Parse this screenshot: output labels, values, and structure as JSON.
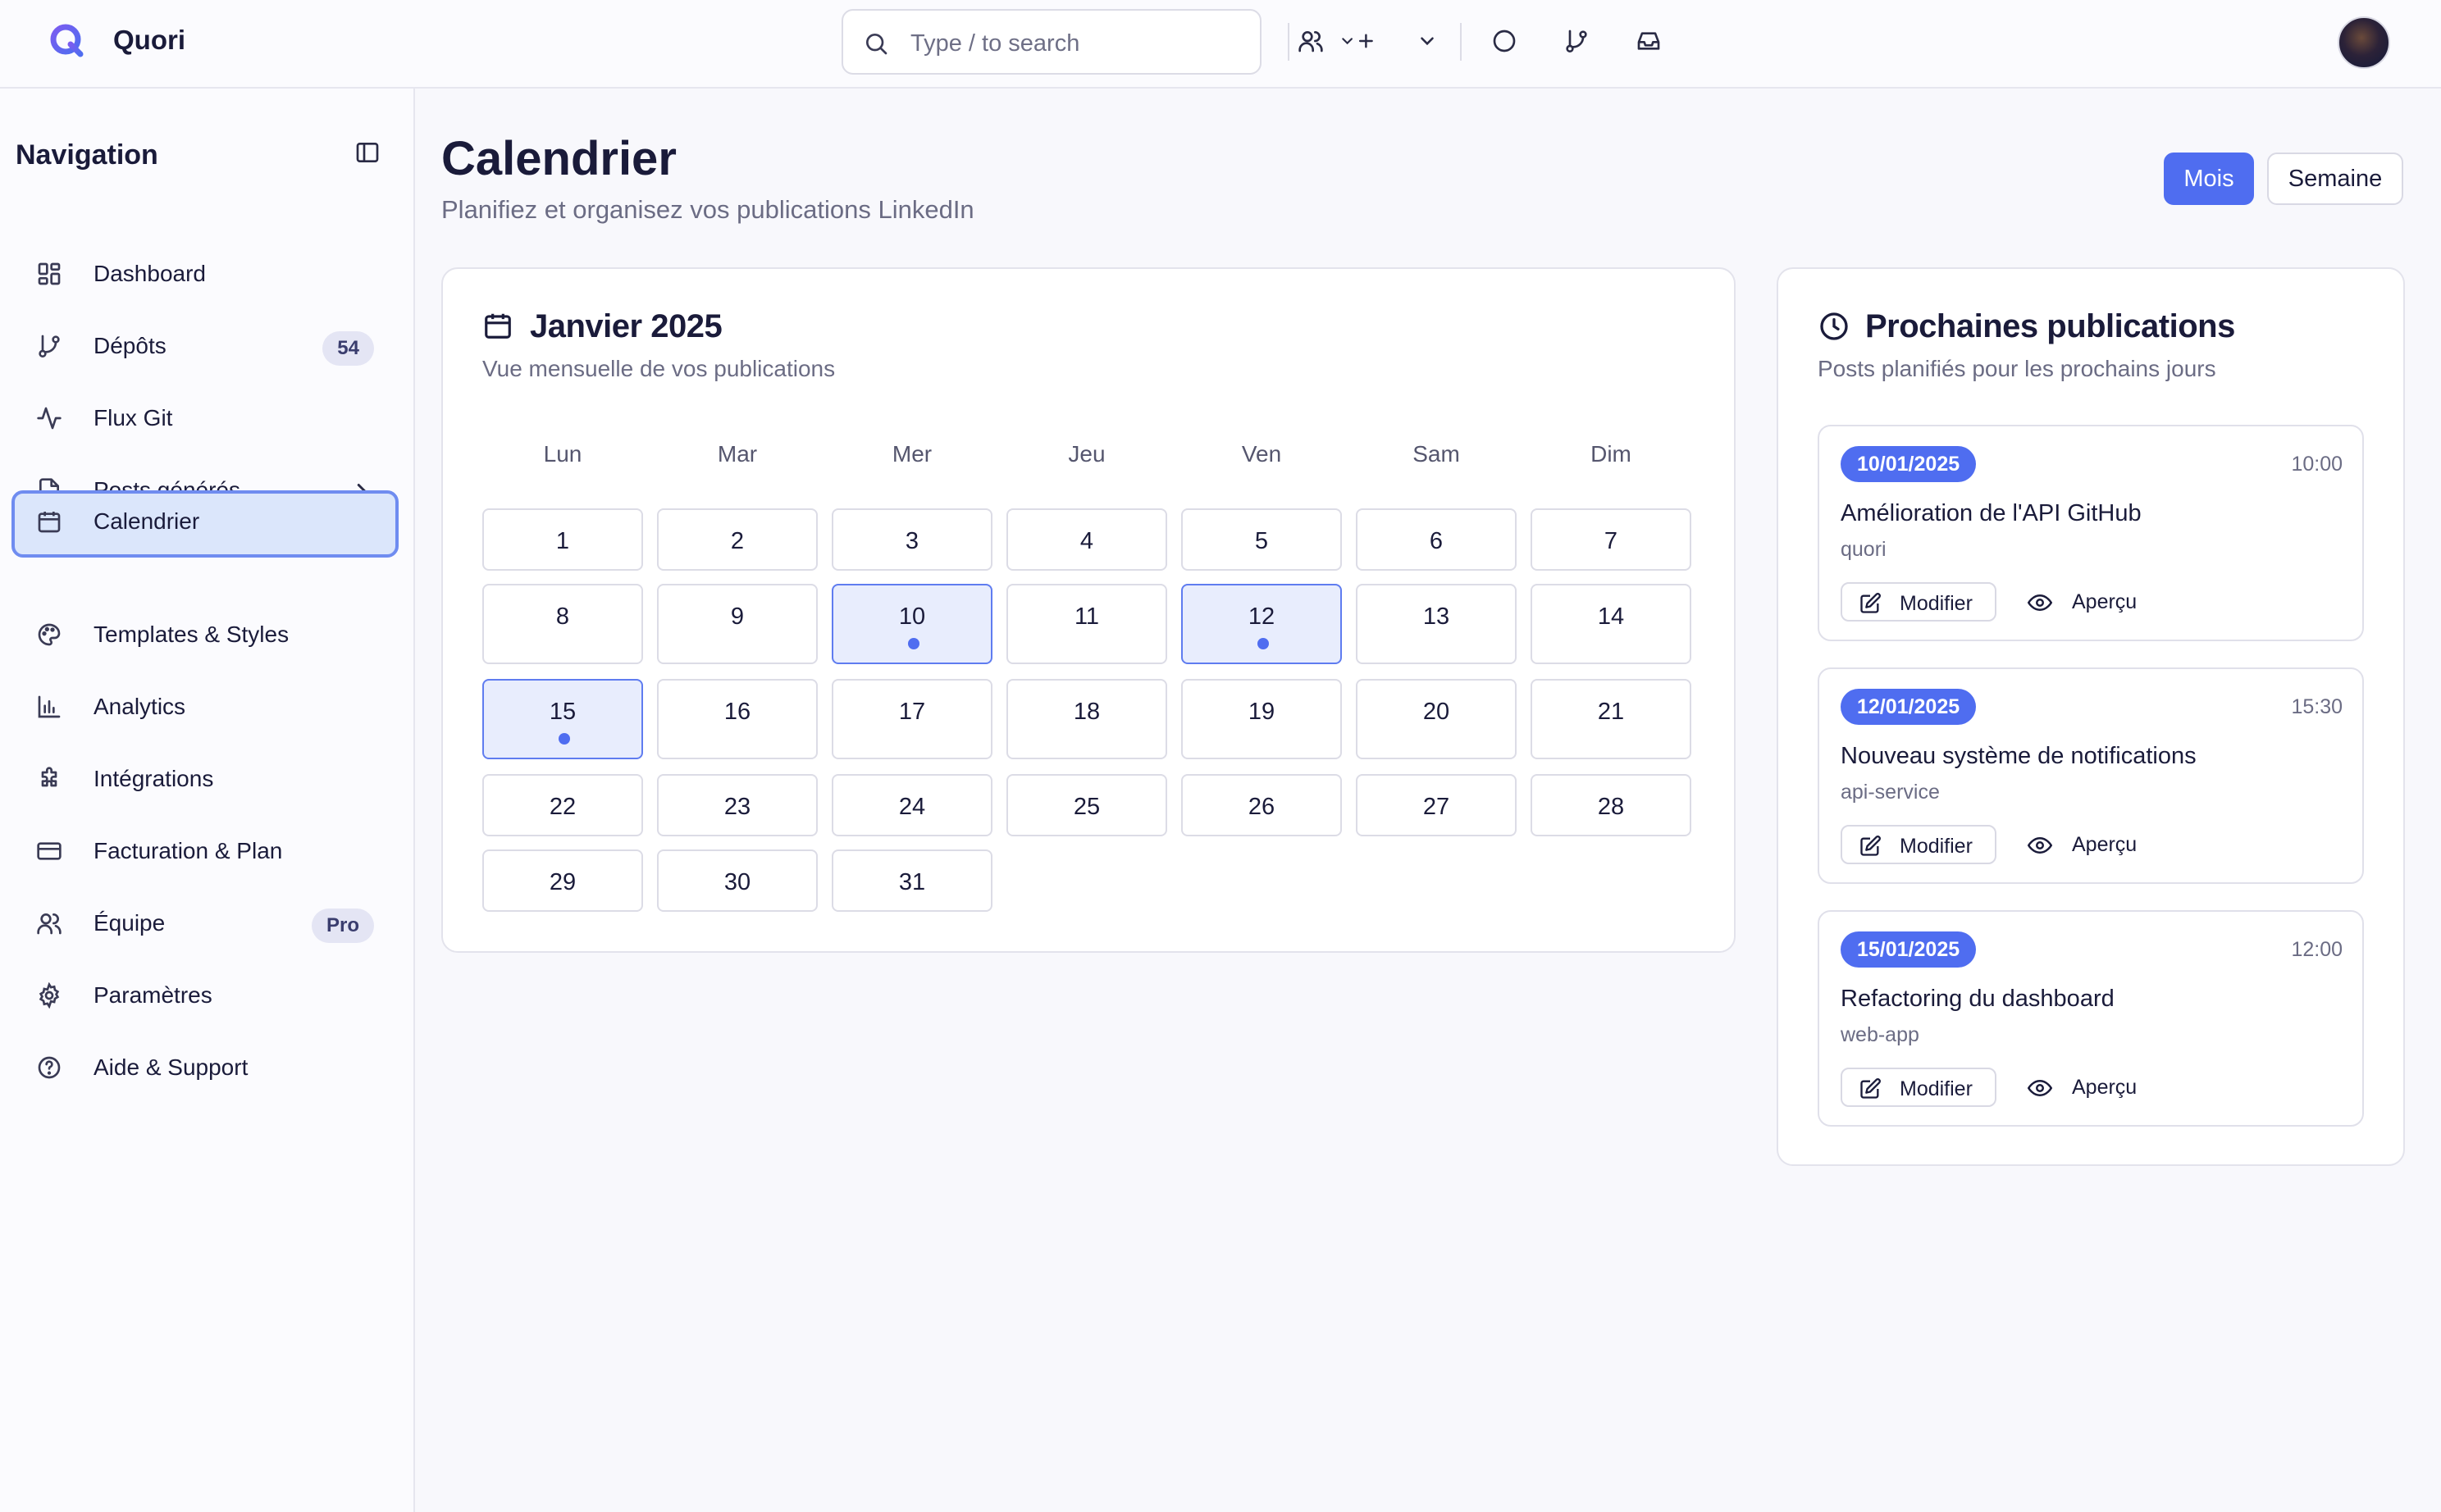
{
  "app": {
    "name": "Quori"
  },
  "topbar": {
    "search_placeholder": "Type / to search"
  },
  "sidebar": {
    "title": "Navigation",
    "items": [
      {
        "label": "Dashboard",
        "icon": "dashboard-icon"
      },
      {
        "label": "Dépôts",
        "icon": "git-branch-icon",
        "badge": "54"
      },
      {
        "label": "Flux Git",
        "icon": "activity-icon"
      },
      {
        "label": "Posts générés",
        "icon": "file-text-icon"
      },
      {
        "label": "Calendrier",
        "icon": "calendar-icon",
        "active": true
      },
      {
        "label": "Templates & Styles",
        "icon": "palette-icon"
      },
      {
        "label": "Analytics",
        "icon": "bar-chart-icon"
      },
      {
        "label": "Intégrations",
        "icon": "puzzle-icon"
      },
      {
        "label": "Facturation & Plan",
        "icon": "credit-card-icon"
      },
      {
        "label": "Équipe",
        "icon": "users-icon",
        "badge": "Pro"
      },
      {
        "label": "Paramètres",
        "icon": "settings-icon"
      },
      {
        "label": "Aide & Support",
        "icon": "help-circle-icon"
      }
    ]
  },
  "page": {
    "title": "Calendrier",
    "subtitle": "Planifiez et organisez vos publications LinkedIn",
    "view_month": "Mois",
    "view_week": "Semaine"
  },
  "calendar": {
    "title": "Janvier 2025",
    "subtitle": "Vue mensuelle de vos publications",
    "weekdays": [
      "Lun",
      "Mar",
      "Mer",
      "Jeu",
      "Ven",
      "Sam",
      "Dim"
    ],
    "days": [
      "1",
      "2",
      "3",
      "4",
      "5",
      "6",
      "7",
      "8",
      "9",
      "10",
      "11",
      "12",
      "13",
      "14",
      "15",
      "16",
      "17",
      "18",
      "19",
      "20",
      "21",
      "22",
      "23",
      "24",
      "25",
      "26",
      "27",
      "28",
      "29",
      "30",
      "31"
    ],
    "days_with_posts": [
      "10",
      "12",
      "15"
    ]
  },
  "upcoming": {
    "title": "Prochaines publications",
    "subtitle": "Posts planifiés pour les prochains jours",
    "posts": [
      {
        "date": "10/01/2025",
        "time": "10:00",
        "title": "Amélioration de l'API GitHub",
        "repo": "quori",
        "edit": "Modifier",
        "preview": "Aperçu"
      },
      {
        "date": "12/01/2025",
        "time": "15:30",
        "title": "Nouveau système de notifications",
        "repo": "api-service",
        "edit": "Modifier",
        "preview": "Aperçu"
      },
      {
        "date": "15/01/2025",
        "time": "12:00",
        "title": "Refactoring du dashboard",
        "repo": "web-app",
        "edit": "Modifier",
        "preview": "Aperçu"
      }
    ]
  },
  "colors": {
    "accent": "#4f6df0",
    "active_nav_bg": "#dbe6fb",
    "post_day_bg": "#e8edfd"
  }
}
